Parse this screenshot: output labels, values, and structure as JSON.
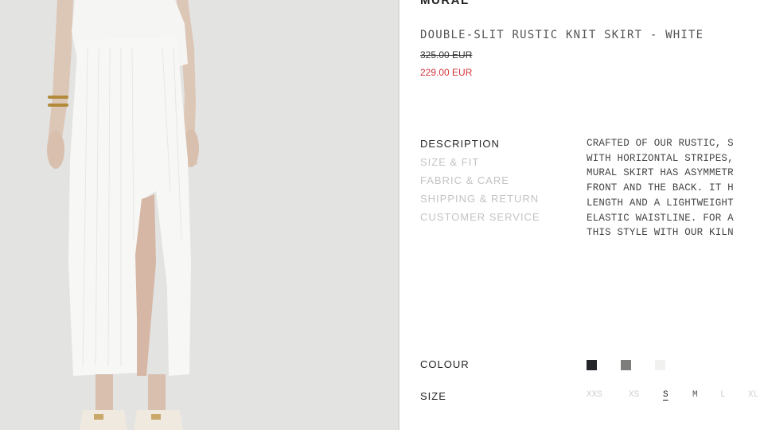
{
  "brand": "MURAL",
  "product": {
    "title": "DOUBLE-SLIT RUSTIC KNIT SKIRT - WHITE",
    "original_price": "325.00 EUR",
    "sale_price": "229.00 EUR"
  },
  "info_tabs": [
    {
      "label": "DESCRIPTION",
      "active": true
    },
    {
      "label": "SIZE & FIT",
      "active": false
    },
    {
      "label": "FABRIC & CARE",
      "active": false
    },
    {
      "label": "SHIPPING & RETURN",
      "active": false
    },
    {
      "label": "CUSTOMER SERVICE",
      "active": false
    }
  ],
  "description_lines": [
    "CRAFTED OF OUR RUSTIC, S",
    "WITH HORIZONTAL STRIPES,",
    "MURAL SKIRT HAS ASYMMETR",
    "FRONT AND THE BACK. IT H",
    "LENGTH AND A LIGHTWEIGHT",
    "ELASTIC WAISTLINE. FOR A",
    "THIS STYLE WITH OUR KILN"
  ],
  "colour": {
    "label": "COLOUR",
    "swatches": [
      {
        "name": "black",
        "hex": "#23252b"
      },
      {
        "name": "grey",
        "hex": "#7d7e7b"
      },
      {
        "name": "white",
        "hex": "#f1f1ef"
      }
    ]
  },
  "size": {
    "label": "SIZE",
    "options": [
      "XXS",
      "XS",
      "S",
      "M",
      "L",
      "XL"
    ],
    "selected": "S"
  }
}
